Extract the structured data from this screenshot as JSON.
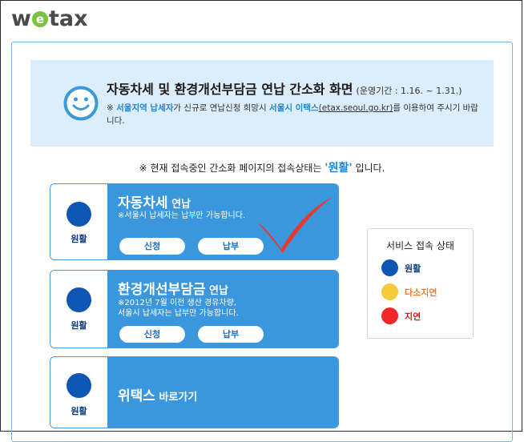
{
  "logo": {
    "pre": "w",
    "e": "e",
    "post": "tax"
  },
  "notice": {
    "title": "자동차세 및 환경개선부담금 연납 간소화 화면",
    "period": "(운영기간 : 1.16. ~ 1.31.)",
    "line_prefix": "※ ",
    "seoul_taxpayer": "서울지역 납세자",
    "mid_text": "가 신규로 연납신청 희망시 ",
    "seoul_etax": "서울시 이택스",
    "etax_url": "(etax.seoul.go.kr)",
    "end_text": "를 이용하여 주시기 바랍니다."
  },
  "status_line": {
    "prefix": "※ 현재 접속중인 간소화 페이지의 접속상태는 ",
    "status": "'원활'",
    "suffix": " 입니다."
  },
  "cards": [
    {
      "status": "원활",
      "title": "자동차세",
      "title_suffix": " 연납",
      "note": "※서울시 납세자는 납부만 가능합니다.",
      "apply": "신청",
      "pay": "납부"
    },
    {
      "status": "원활",
      "title": "환경개선부담금",
      "title_suffix": " 연납",
      "note_line1": "※2012년 7월 이전 생산 경유차량,",
      "note_line2": "서울시 납세자는 납부만 가능합니다.",
      "apply": "신청",
      "pay": "납부"
    },
    {
      "status": "원활",
      "title": "위택스",
      "title_suffix": " 바로가기"
    }
  ],
  "legend": {
    "title": "서비스 접속 상태",
    "items": [
      {
        "label": "원활",
        "color": "#0d56b3"
      },
      {
        "label": "다소지연",
        "color": "#f5cb3b"
      },
      {
        "label": "지연",
        "color": "#ee2828"
      }
    ]
  },
  "colors": {
    "accent": "#3a97de",
    "status_smooth": "#0d56b3",
    "status_slow": "#f5cb3b",
    "status_delay": "#ee2828",
    "checkmark": "#e8392f"
  },
  "icons": [
    "smiley-icon",
    "checkmark-icon"
  ]
}
